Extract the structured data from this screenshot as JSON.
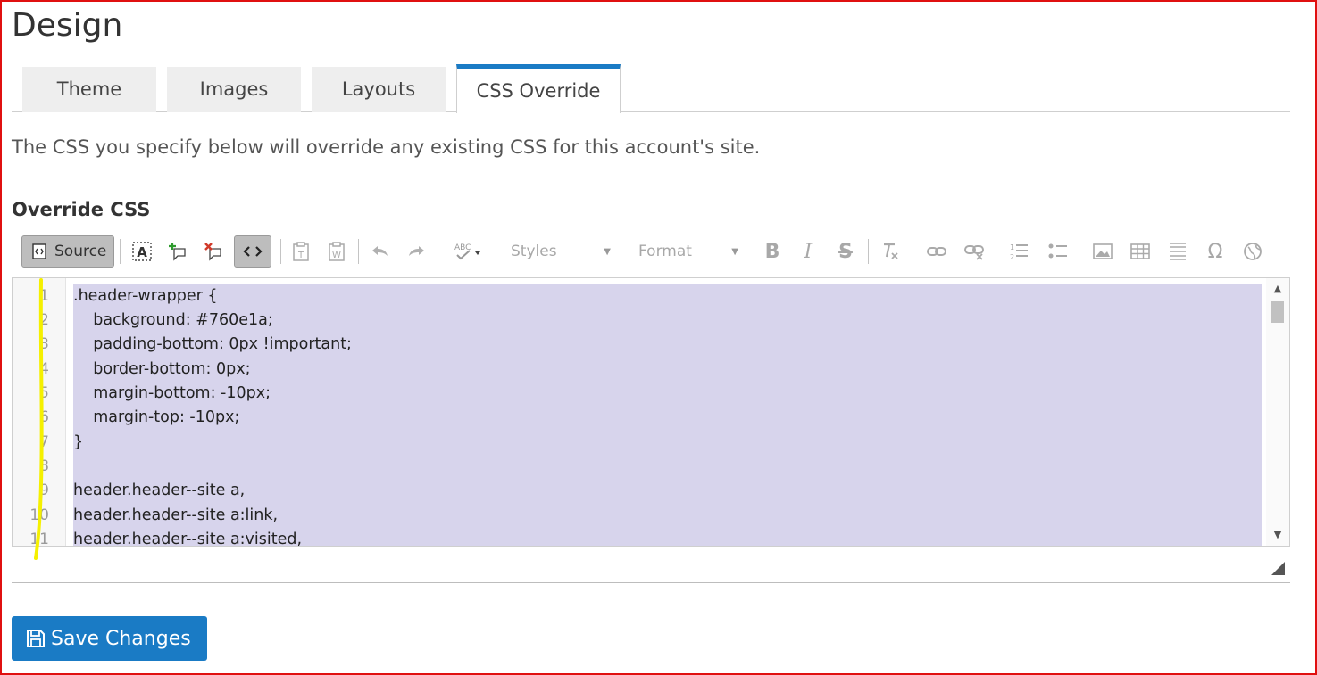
{
  "page": {
    "title": "Design"
  },
  "tabs": [
    {
      "label": "Theme",
      "active": false
    },
    {
      "label": "Images",
      "active": false
    },
    {
      "label": "Layouts",
      "active": false
    },
    {
      "label": "CSS Override",
      "active": true
    }
  ],
  "description": "The CSS you specify below will override any existing CSS for this account's site.",
  "section_label": "Override CSS",
  "toolbar": {
    "source_label": "Source",
    "styles_label": "Styles",
    "format_label": "Format",
    "buttons": [
      "source",
      "select-all",
      "show-blocks",
      "remove-format-blocks",
      "code-snippet",
      "paste-text",
      "paste-word",
      "undo",
      "redo",
      "spell-check",
      "styles",
      "format",
      "bold",
      "italic",
      "strike",
      "remove-format",
      "link",
      "unlink",
      "numbered-list",
      "bulleted-list",
      "image",
      "table",
      "horizontal-rule",
      "special-char",
      "iframe"
    ],
    "icons": {
      "source": "source-icon",
      "bold": "B",
      "italic": "I",
      "strike": "S",
      "omega": "Ω"
    }
  },
  "editor": {
    "line_numbers": [
      "1",
      "2",
      "3",
      "4",
      "5",
      "6",
      "7",
      "8",
      "9",
      "10",
      "11"
    ],
    "lines": [
      ".header-wrapper {",
      "    background: #760e1a;",
      "    padding-bottom: 0px !important;",
      "    border-bottom: 0px;",
      "    margin-bottom: -10px;",
      "    margin-top: -10px;",
      "}",
      "",
      "header.header--site a,",
      "header.header--site a:link,",
      "header.header--site a:visited,"
    ]
  },
  "save_button": {
    "label": "Save Changes"
  },
  "colors": {
    "accent": "#1a7bc5",
    "selection": "#d7d4ec",
    "frame": "#e01010",
    "highlight": "#f5f000"
  }
}
